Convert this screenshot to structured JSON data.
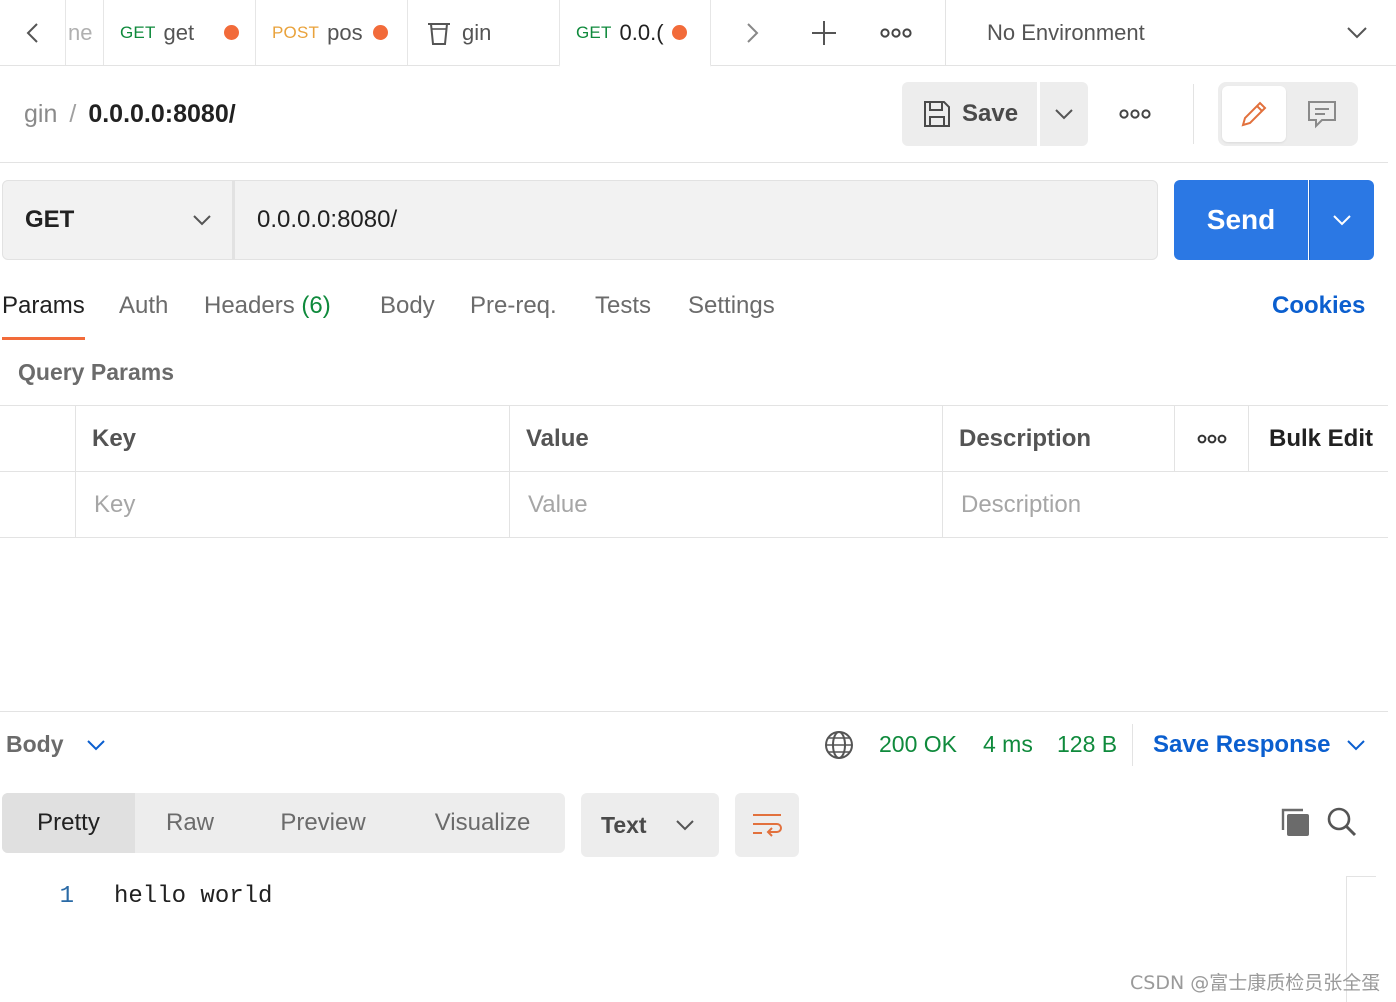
{
  "tabbar": {
    "tabs": [
      {
        "partial": "ne"
      },
      {
        "method": "GET",
        "name": "get"
      },
      {
        "method": "POST",
        "name": "pos"
      },
      {
        "name": "gin"
      },
      {
        "method": "GET",
        "name": "0.0.("
      }
    ],
    "environment": "No Environment"
  },
  "header": {
    "breadcrumb_parent": "gin",
    "breadcrumb_sep": "/",
    "breadcrumb_current": "0.0.0.0:8080/",
    "save_label": "Save"
  },
  "request": {
    "method": "GET",
    "url": "0.0.0.0:8080/",
    "send_label": "Send"
  },
  "request_tabs": {
    "params": "Params",
    "auth": "Auth",
    "headers": "Headers",
    "headers_count": "(6)",
    "body": "Body",
    "prereq": "Pre-req.",
    "tests": "Tests",
    "settings": "Settings",
    "cookies": "Cookies"
  },
  "query_params": {
    "title": "Query Params",
    "columns": {
      "key": "Key",
      "value": "Value",
      "description": "Description",
      "bulk_edit": "Bulk Edit"
    },
    "placeholders": {
      "key": "Key",
      "value": "Value",
      "description": "Description"
    }
  },
  "response": {
    "label": "Body",
    "status": "200 OK",
    "time": "4 ms",
    "size": "128 B",
    "save_response": "Save Response",
    "views": {
      "pretty": "Pretty",
      "raw": "Raw",
      "preview": "Preview",
      "visualize": "Visualize"
    },
    "format": "Text",
    "lines": [
      {
        "number": "1",
        "text": "hello world"
      }
    ]
  },
  "watermark": "CSDN @富士康质检员张全蛋",
  "colors": {
    "accent_orange": "#f26b3a",
    "send_blue": "#2b78e4",
    "link_blue": "#0b5fcf",
    "method_get": "#0f8a3c",
    "method_post": "#e9a23b",
    "status_green": "#0f8a3c"
  },
  "icons": {
    "nav_back": "chevron-left-icon",
    "nav_forward": "chevron-right-icon",
    "new_tab": "plus-icon",
    "more": "more-horizontal-icon",
    "env_dropdown": "chevron-down-icon",
    "collection_tab": "trash-can-icon",
    "save": "floppy-disk-icon",
    "edit_mode": "pencil-icon",
    "comments_mode": "comment-icon",
    "network": "globe-icon",
    "wrap": "wrap-lines-icon",
    "copy": "copy-icon",
    "search": "search-icon"
  }
}
